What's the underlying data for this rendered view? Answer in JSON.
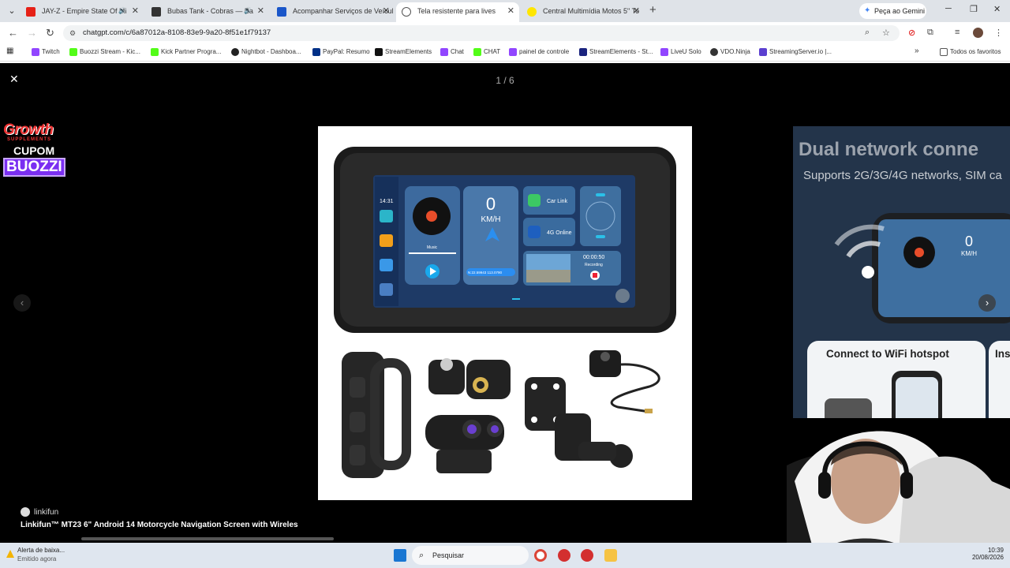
{
  "browser": {
    "tabs": [
      {
        "title": "JAY-Z - Empire State Of Mi",
        "active": false,
        "audio": true
      },
      {
        "title": "Bubas Tank - Cobras — Ba",
        "active": false,
        "audio": true
      },
      {
        "title": "Acompanhar Serviços de Veícul",
        "active": false,
        "audio": false
      },
      {
        "title": "Tela resistente para lives",
        "active": true,
        "audio": false
      },
      {
        "title": "Central Multimídia Motos 5\" To",
        "active": false,
        "audio": false
      }
    ],
    "gemini_label": "Peça ao Gemini",
    "url": "chatgpt.com/c/6a87012a-8108-83e9-9a20-8f51e1f79137",
    "bookmarks": [
      "Twitch",
      "Buozzi Stream - Kic...",
      "Kick Partner Progra...",
      "Nightbot - Dashboa...",
      "PayPal: Resumo",
      "StreamElements",
      "Chat",
      "CHAT",
      "painel de controle",
      "StreamElements - St...",
      "LiveU Solo",
      "VDO.Ninja",
      "StreamingServer.io |..."
    ],
    "bookmarks_all": "Todos os favoritos"
  },
  "viewer": {
    "counter": "1 / 6",
    "source": "linkifun",
    "caption": "Linkifun™ MT23 6\" Android 14 Motorcycle Navigation Screen with Wireles",
    "side_title": "Dual network conne",
    "side_subtitle": "Supports 2G/3G/4G networks, SIM ca",
    "side_card": "Connect to WiFi hotspot",
    "side_card2": "Ins"
  },
  "device_screen": {
    "time": "14:31",
    "speed": "0",
    "speed_unit": "KM/H",
    "music_label": "Music",
    "carlink": "Car Link",
    "online": "4G Online",
    "rec_time": "00:00:50",
    "rec_label": "Recording",
    "coords": "N:22.59943 113.0790"
  },
  "side_screen": {
    "speed": "0",
    "speed_unit": "KM/H"
  },
  "overlay": {
    "brand": "Growth",
    "brand_sub": "SUPPLEMENTS",
    "coupon": "CUPOM",
    "code": "BUOZZI"
  },
  "taskbar": {
    "notif_title": "Alerta de baixa...",
    "notif_sub": "Emitido agora",
    "search": "Pesquisar",
    "time": "10:39",
    "date": "20/08/2026"
  },
  "colors": {
    "accent": "#7b2ff2",
    "brand_red": "#e33333",
    "chrome_bg": "#dfe3e8"
  }
}
